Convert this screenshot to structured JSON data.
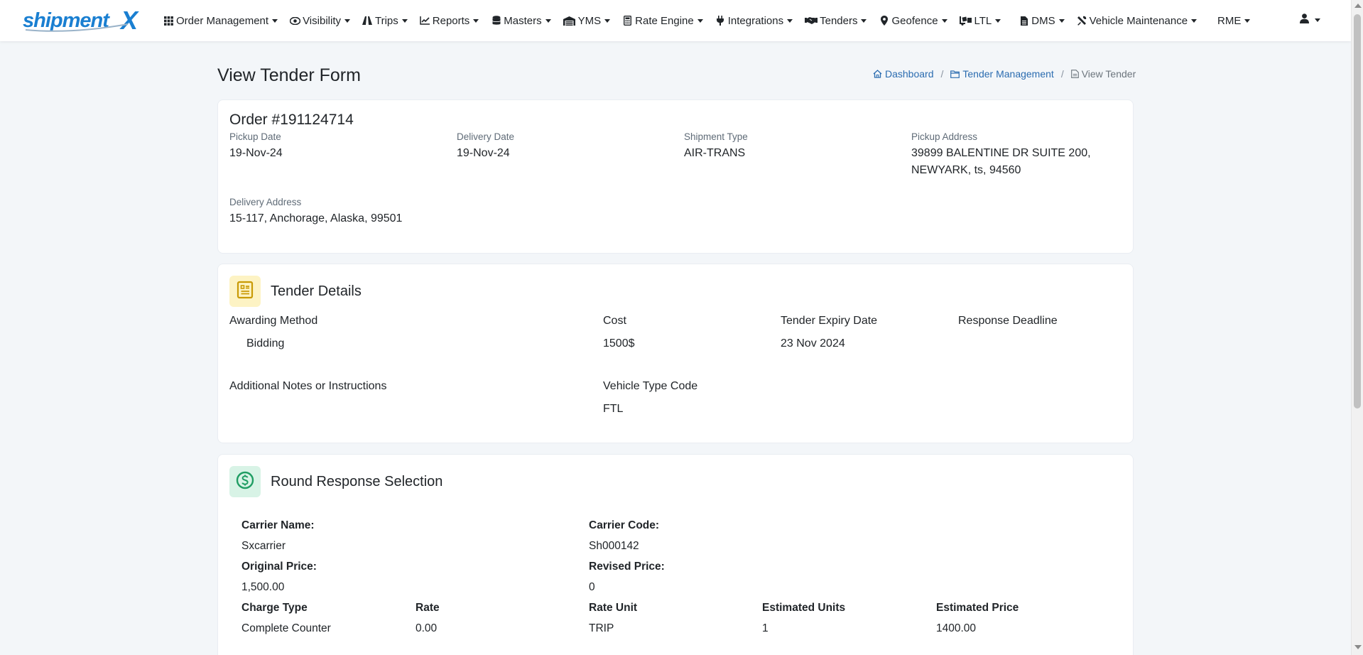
{
  "brand": {
    "name_part1": "shipment",
    "name_part2": "X"
  },
  "nav": {
    "items": [
      {
        "label": "Order Management",
        "icon": "grid-icon"
      },
      {
        "label": "Visibility",
        "icon": "eye-icon"
      },
      {
        "label": "Trips",
        "icon": "road-icon"
      },
      {
        "label": "Reports",
        "icon": "chart-line-icon"
      },
      {
        "label": "Masters",
        "icon": "database-icon"
      },
      {
        "label": "YMS",
        "icon": "warehouse-icon"
      },
      {
        "label": "Rate Engine",
        "icon": "calculator-icon"
      },
      {
        "label": "Integrations",
        "icon": "plug-icon"
      },
      {
        "label": "Tenders",
        "icon": "handshake-icon"
      },
      {
        "label": "Geofence",
        "icon": "map-marker-icon"
      },
      {
        "label": "LTL",
        "icon": "truck-loading-icon"
      },
      {
        "label": "DMS",
        "icon": "file-icon"
      },
      {
        "label": "Vehicle Maintenance",
        "icon": "tools-icon"
      },
      {
        "label": "RME",
        "icon": ""
      }
    ],
    "user_icon": "user-icon"
  },
  "page": {
    "title": "View Tender Form"
  },
  "breadcrumb": {
    "dashboard": "Dashboard",
    "tender_management": "Tender Management",
    "current": "View Tender"
  },
  "order": {
    "title": "Order #191124714",
    "pickup_date_label": "Pickup Date",
    "pickup_date": "19-Nov-24",
    "delivery_date_label": "Delivery Date",
    "delivery_date": "19-Nov-24",
    "shipment_type_label": "Shipment Type",
    "shipment_type": "AIR-TRANS",
    "pickup_address_label": "Pickup Address",
    "pickup_address_line1": "39899 BALENTINE DR SUITE 200,",
    "pickup_address_line2": "NEWYARK, ts, 94560",
    "delivery_address_label": "Delivery Address",
    "delivery_address": "15-117, Anchorage, Alaska, 99501"
  },
  "tender": {
    "section_title": "Tender Details",
    "awarding_method_label": "Awarding Method",
    "awarding_method": "Bidding",
    "cost_label": "Cost",
    "cost": "1500$",
    "expiry_label": "Tender Expiry Date",
    "expiry": "23 Nov 2024",
    "deadline_label": "Response Deadline",
    "notes_label": "Additional Notes or Instructions",
    "vehicle_type_label": "Vehicle Type Code",
    "vehicle_type": "FTL"
  },
  "round": {
    "section_title": "Round Response Selection",
    "carrier_name_label": "Carrier Name:",
    "carrier_name": "Sxcarrier",
    "carrier_code_label": "Carrier Code:",
    "carrier_code": "Sh000142",
    "original_price_label": "Original Price:",
    "original_price": "1,500.00",
    "revised_price_label": "Revised Price:",
    "revised_price": "0",
    "charges": {
      "headers": [
        "Charge Type",
        "Rate",
        "Rate Unit",
        "Estimated Units",
        "Estimated Price"
      ],
      "rows": [
        [
          "Complete Counter",
          "0.00",
          "TRIP",
          "1",
          "1400.00"
        ]
      ]
    }
  },
  "colors": {
    "brand_blue": "#1a7fd1",
    "link": "#2b6cb0",
    "tender_icon_bg": "#fdf3c4",
    "tender_icon": "#c99a06",
    "round_icon_bg": "#d8f3e6",
    "round_icon": "#1f9d63"
  }
}
